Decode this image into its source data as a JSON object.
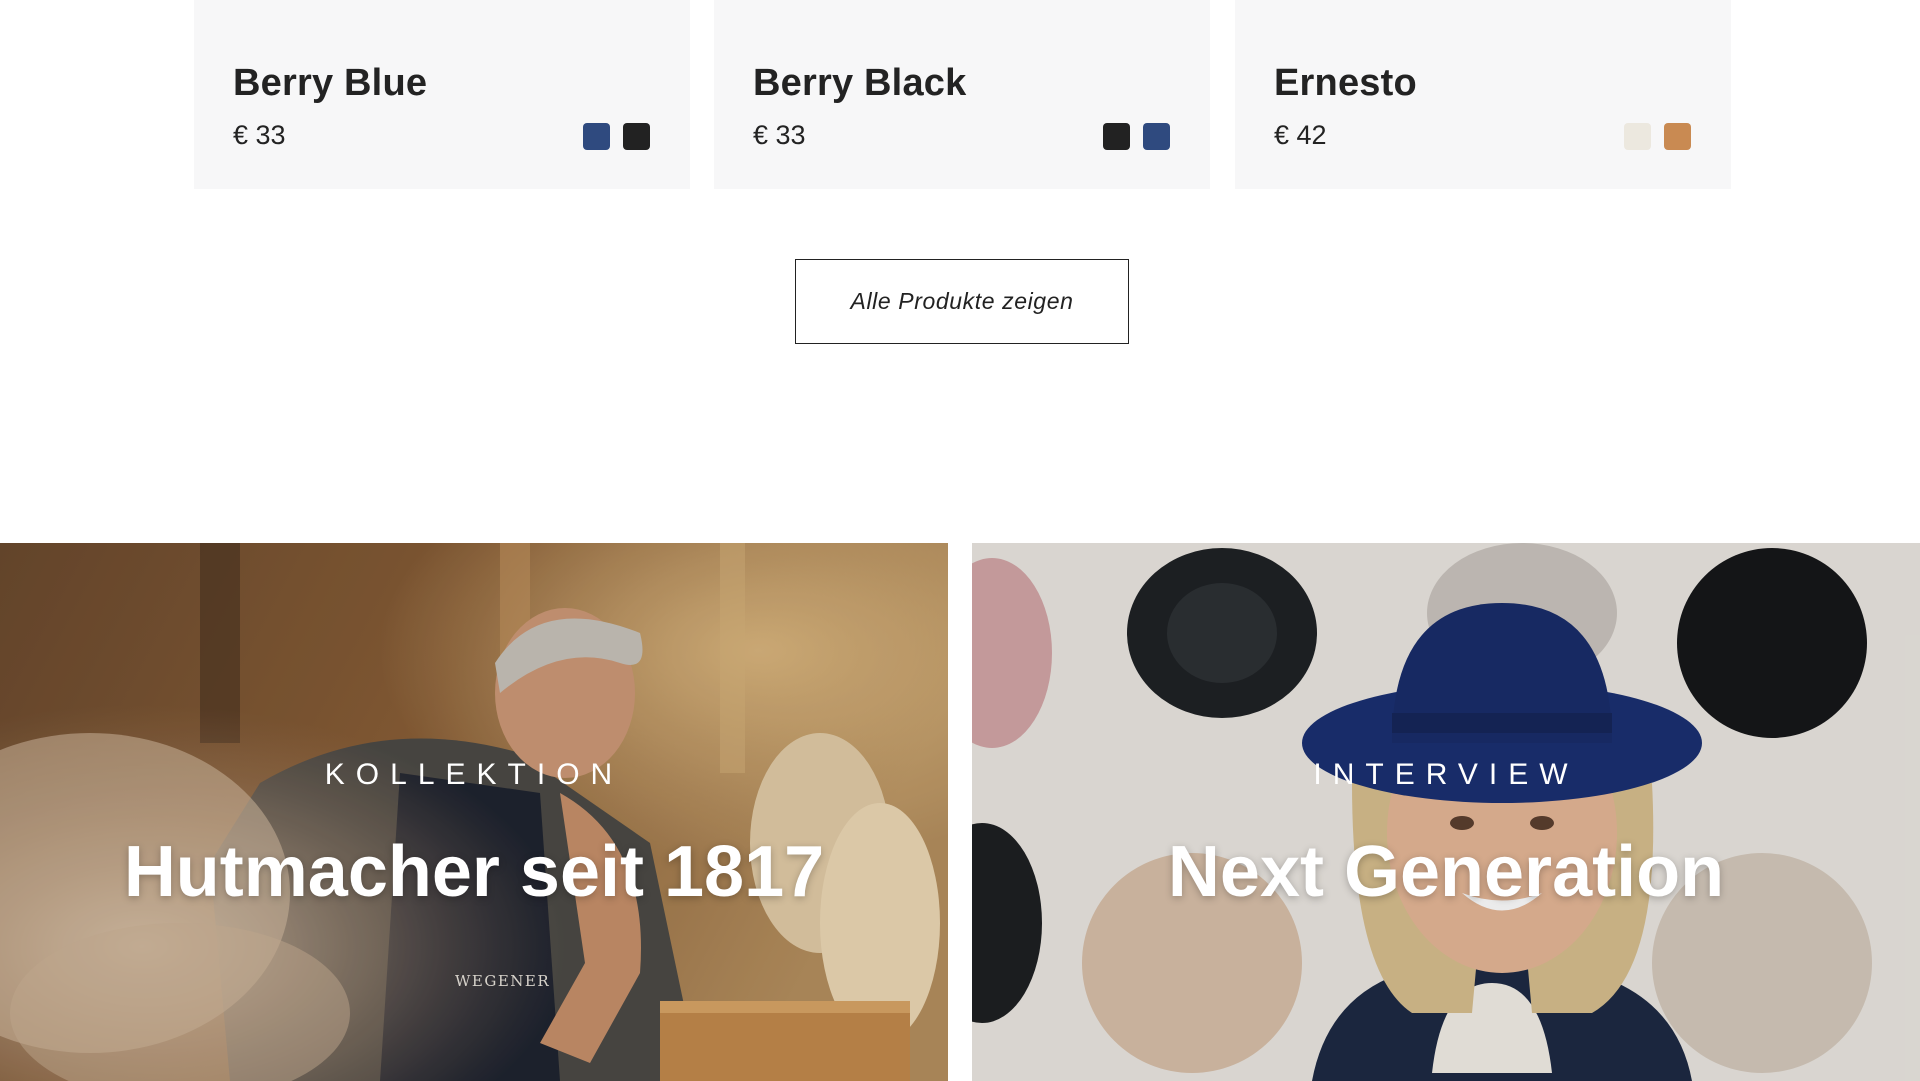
{
  "products": [
    {
      "name": "Berry Blue",
      "price": "€ 33",
      "swatches": [
        "#2f4a7f",
        "#222222"
      ]
    },
    {
      "name": "Berry Black",
      "price": "€ 33",
      "swatches": [
        "#222222",
        "#2f4a7f"
      ]
    },
    {
      "name": "Ernesto",
      "price": "€ 42",
      "swatches": [
        "#ece8df",
        "#c98a52"
      ]
    }
  ],
  "cta": {
    "label": "Alle Produkte zeigen"
  },
  "tiles": [
    {
      "eyebrow": "KOLLEKTION",
      "headline": "Hutmacher seit 1817",
      "apron_logo": "WEGENER"
    },
    {
      "eyebrow": "INTERVIEW",
      "headline": "Next Generation"
    }
  ]
}
